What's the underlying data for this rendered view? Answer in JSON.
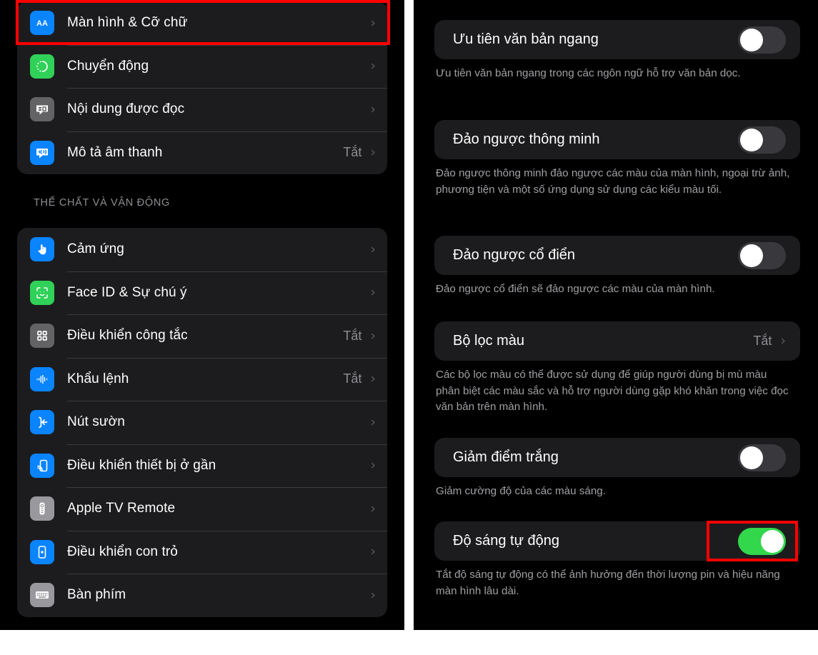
{
  "left_panel": {
    "group1": {
      "items": [
        {
          "label": "Màn hình & Cỡ chữ",
          "value": "",
          "icon": "text-size-icon",
          "icon_bg": "#0a84ff",
          "highlighted": true
        },
        {
          "label": "Chuyển động",
          "value": "",
          "icon": "motion-icon",
          "icon_bg": "#30d158",
          "highlighted": false
        },
        {
          "label": "Nội dung được đọc",
          "value": "",
          "icon": "spoken-content-icon",
          "icon_bg": "#636366",
          "highlighted": false
        },
        {
          "label": "Mô tả âm thanh",
          "value": "Tắt",
          "icon": "audio-description-icon",
          "icon_bg": "#0a84ff",
          "highlighted": false
        }
      ]
    },
    "group2": {
      "header": "THỂ CHẤT VÀ VẬN ĐỘNG",
      "items": [
        {
          "label": "Cảm ứng",
          "value": "",
          "icon": "touch-icon",
          "icon_bg": "#0a84ff"
        },
        {
          "label": "Face ID & Sự chú ý",
          "value": "",
          "icon": "face-id-icon",
          "icon_bg": "#30d158"
        },
        {
          "label": "Điều khiển công tắc",
          "value": "Tắt",
          "icon": "switch-control-icon",
          "icon_bg": "#636366"
        },
        {
          "label": "Khẩu lệnh",
          "value": "Tắt",
          "icon": "voice-control-icon",
          "icon_bg": "#0a84ff"
        },
        {
          "label": "Nút sườn",
          "value": "",
          "icon": "side-button-icon",
          "icon_bg": "#0a84ff"
        },
        {
          "label": "Điều khiển thiết bị ở gần",
          "value": "",
          "icon": "nearby-device-control-icon",
          "icon_bg": "#0a84ff"
        },
        {
          "label": "Apple TV Remote",
          "value": "",
          "icon": "apple-tv-remote-icon",
          "icon_bg": "#98989d"
        },
        {
          "label": "Điều khiển con trỏ",
          "value": "",
          "icon": "pointer-control-icon",
          "icon_bg": "#0a84ff"
        },
        {
          "label": "Bàn phím",
          "value": "",
          "icon": "keyboard-icon",
          "icon_bg": "#98989d"
        }
      ]
    },
    "chevron": "›"
  },
  "right_panel": {
    "sections": [
      {
        "label": "Ưu tiên văn bản ngang",
        "control": "toggle",
        "state": "off",
        "description": "Ưu tiên văn bản ngang trong các ngôn ngữ hỗ trợ văn bản dọc."
      },
      {
        "label": "Đảo ngược thông minh",
        "control": "toggle",
        "state": "off",
        "description": "Đảo ngược thông minh đảo ngược các màu của màn hình, ngoại trừ ảnh, phương tiện và một số ứng dụng sử dụng các kiểu màu tối."
      },
      {
        "label": "Đảo ngược cổ điển",
        "control": "toggle",
        "state": "off",
        "description": "Đảo ngược cổ điển sẽ đảo ngược các màu của màn hình."
      },
      {
        "label": "Bộ lọc màu",
        "control": "disclosure",
        "value": "Tắt",
        "description": "Các bộ lọc màu có thể được sử dụng để giúp người dùng bị mù màu phân biệt các màu sắc và hỗ trợ người dùng gặp khó khăn trong việc đọc văn bản trên màn hình."
      },
      {
        "label": "Giảm điểm trắng",
        "control": "toggle",
        "state": "off",
        "description": "Giảm cường độ của các màu sáng."
      },
      {
        "label": "Độ sáng tự động",
        "control": "toggle",
        "state": "on",
        "highlighted": true,
        "description": "Tắt độ sáng tự động có thể ảnh hưởng đến thời lượng pin và hiệu năng màn hình lâu dài."
      }
    ],
    "chevron": "›"
  },
  "colors": {
    "page_background": "#000000",
    "card_background": "#1c1c1e",
    "accent_blue": "#0a84ff",
    "accent_green": "#30d158",
    "toggle_on": "#32d74b",
    "toggle_off": "#39393d",
    "highlight_red": "#ff0000",
    "secondary_text": "#8e8e93"
  }
}
